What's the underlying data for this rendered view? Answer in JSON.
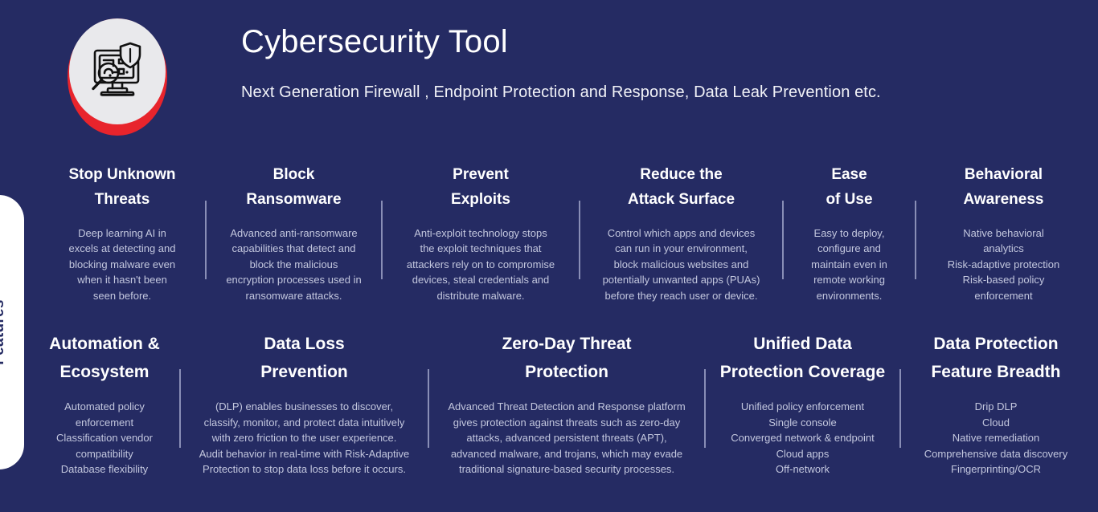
{
  "header": {
    "title": "Cybersecurity Tool",
    "subtitle": "Next Generation Firewall , Endpoint Protection and Response, Data Leak Prevention etc.",
    "logo_icon": "monitor-magnifier-shield-icon"
  },
  "sidebar": {
    "label": "Features"
  },
  "colors": {
    "background": "#252b63",
    "accent_red": "#e8242c",
    "logo_disc": "#e9e9ec",
    "title": "#ffffff",
    "body_text": "#c3c7de",
    "divider": "#9ba0c4",
    "pill": "#ffffff"
  },
  "rows": [
    {
      "name": "features-row-1",
      "cards": [
        {
          "title": "Stop Unknown\nThreats",
          "body": "Deep learning AI in\nexcels at detecting and\nblocking malware even\nwhen it hasn't been\nseen before."
        },
        {
          "title": "Block\nRansomware",
          "body": "Advanced anti-ransomware\ncapabilities that detect and\nblock the malicious\nencryption processes used in\nransomware attacks."
        },
        {
          "title": "Prevent\nExploits",
          "body": "Anti-exploit technology stops\nthe exploit techniques that\nattackers rely on to compromise\ndevices, steal credentials and\ndistribute malware."
        },
        {
          "title": "Reduce the\nAttack Surface",
          "body": "Control which apps and devices\ncan run in your environment,\nblock malicious websites and\npotentially unwanted apps (PUAs)\nbefore they reach user or device."
        },
        {
          "title": "Ease\nof Use",
          "body": "Easy to deploy,\nconfigure and\nmaintain even in\nremote working\nenvironments."
        },
        {
          "title": "Behavioral\nAwareness",
          "body": "Native behavioral\nanalytics\nRisk-adaptive protection\nRisk-based policy\nenforcement"
        }
      ]
    },
    {
      "name": "features-row-2",
      "cards": [
        {
          "title": "Automation &\nEcosystem",
          "body": "Automated policy\nenforcement\nClassification vendor\ncompatibility\nDatabase flexibility"
        },
        {
          "title": "Data Loss\nPrevention",
          "body": "(DLP) enables businesses to discover,\nclassify, monitor, and protect data intuitively\nwith zero friction to the user experience.\nAudit behavior in real-time with Risk-Adaptive\nProtection to stop data loss before it occurs."
        },
        {
          "title": "Zero-Day Threat\nProtection",
          "body": "Advanced Threat Detection and Response platform\ngives protection against threats such as zero-day\nattacks, advanced persistent threats (APT),\nadvanced malware, and trojans, which may evade\ntraditional signature-based security processes."
        },
        {
          "title": "Unified Data\nProtection Coverage",
          "body": "Unified policy enforcement\nSingle console\nConverged network & endpoint\nCloud apps\nOff-network"
        },
        {
          "title": "Data Protection\nFeature Breadth",
          "body": "Drip DLP\nCloud\nNative remediation\nComprehensive data discovery\nFingerprinting/OCR"
        }
      ]
    }
  ]
}
